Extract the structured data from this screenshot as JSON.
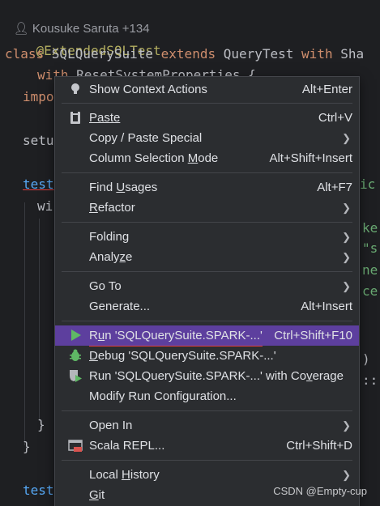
{
  "editor": {
    "author_line": "Kousuke Saruta +134",
    "lines": [
      {
        "a": "@ExtendedSQLTest"
      },
      {
        "kw1": "class ",
        "cls": "SQLQuerySuite ",
        "kw2": "extends ",
        "cls2": "QueryTest ",
        "kw3": "with ",
        "rest": "Sha"
      },
      {
        "kw": "with ",
        "rest": "ResetSystemProperties {"
      },
      {
        "kw": "impo"
      },
      {
        "rest": "setu"
      },
      {
        "fn": "test",
        "tail": "ic"
      },
      {
        "rest": "wi"
      },
      {
        "tail": "ke"
      },
      {
        "tail": "\"s"
      },
      {
        "tail": "ne"
      },
      {
        "tail": "ce"
      },
      {
        "rest": ")"
      },
      {
        "rest": "::"
      },
      {
        "rest": "}"
      },
      {
        "rest": "}"
      },
      {
        "fn": "test"
      }
    ]
  },
  "menu": {
    "show_context_actions": {
      "label": "Show Context Actions",
      "shortcut": "Alt+Enter"
    },
    "paste": {
      "label": "Paste",
      "shortcut": "Ctrl+V"
    },
    "copy_paste_special": {
      "label": "Copy / Paste Special"
    },
    "column_selection": {
      "label_pre": "Column Selection ",
      "label_u": "M",
      "label_post": "ode",
      "shortcut": "Alt+Shift+Insert"
    },
    "find_usages": {
      "label_pre": "Find ",
      "label_u": "U",
      "label_post": "sages",
      "shortcut": "Alt+F7"
    },
    "refactor": {
      "label_u": "R",
      "label_post": "efactor"
    },
    "folding": {
      "label": "Folding"
    },
    "analyze": {
      "label_pre": "Analy",
      "label_u": "z",
      "label_post": "e"
    },
    "go_to": {
      "label": "Go To"
    },
    "generate": {
      "label": "Generate...",
      "shortcut": "Alt+Insert"
    },
    "run": {
      "label_pre": "R",
      "label_u": "u",
      "label_post": "n 'SQLQuerySuite.SPARK-...'",
      "shortcut": "Ctrl+Shift+F10"
    },
    "debug": {
      "label_u": "D",
      "label_post": "ebug 'SQLQuerySuite.SPARK-...'"
    },
    "coverage": {
      "label": "Run 'SQLQuerySuite.SPARK-...' with Co",
      "label_u": "v",
      "label_post": "erage"
    },
    "modify_run": {
      "label": "Modify Run Configuration..."
    },
    "open_in": {
      "label": "Open In"
    },
    "scala_repl": {
      "label": "Scala REPL...",
      "shortcut": "Ctrl+Shift+D"
    },
    "local_history": {
      "label_pre": "Local ",
      "label_u": "H",
      "label_post": "istory"
    },
    "git": {
      "label_u": "G",
      "label_post": "it"
    }
  },
  "watermark": "CSDN @Empty-cup",
  "colors": {
    "highlight": "#5d3f9e",
    "menu_bg": "#2b2d30",
    "editor_bg": "#1e1f22"
  }
}
